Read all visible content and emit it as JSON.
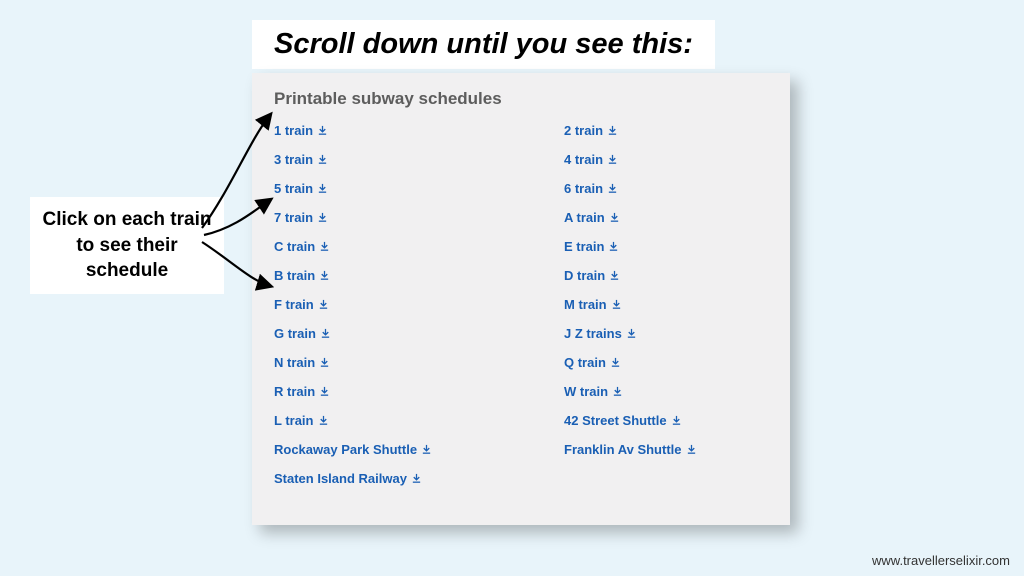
{
  "headline": "Scroll down until you see this:",
  "panel": {
    "title": "Printable subway schedules",
    "left": [
      "1 train",
      "3 train",
      "5 train",
      "7 train",
      "C train",
      "B train",
      "F train",
      "G train",
      "N train",
      "R train",
      "L train",
      "Rockaway Park Shuttle",
      "Staten Island Railway"
    ],
    "right": [
      "2 train",
      "4 train",
      "6 train",
      "A train",
      "E train",
      "D train",
      "M train",
      "J Z trains",
      "Q train",
      "W train",
      "42 Street Shuttle",
      "Franklin Av Shuttle"
    ]
  },
  "callout": "Click on each train to see their schedule",
  "footer": "www.travellerselixir.com"
}
